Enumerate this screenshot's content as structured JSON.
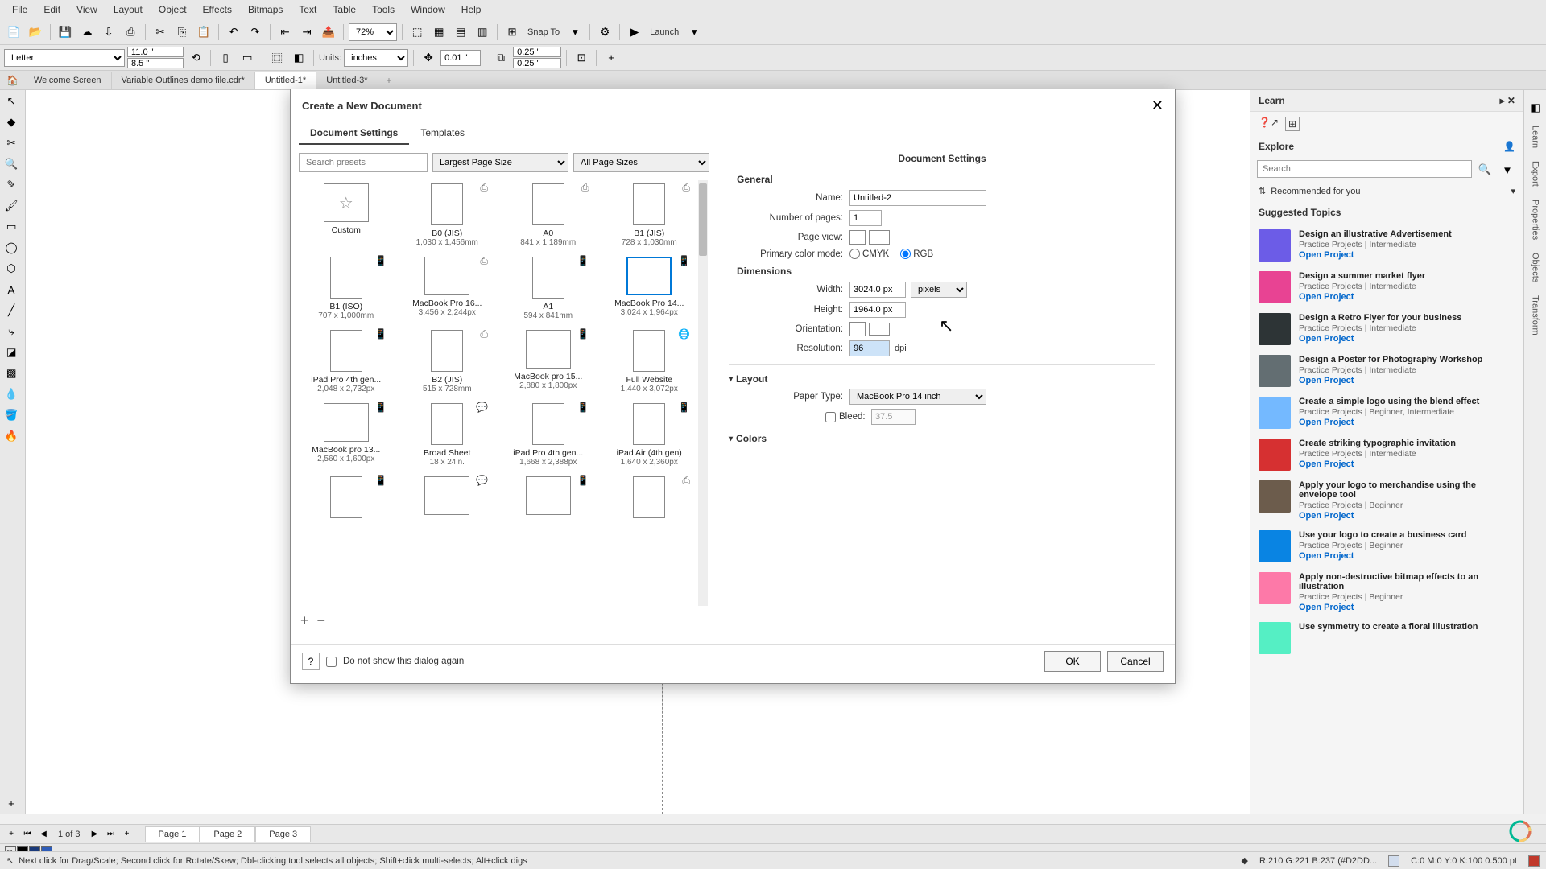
{
  "menubar": [
    "File",
    "Edit",
    "View",
    "Layout",
    "Object",
    "Effects",
    "Bitmaps",
    "Text",
    "Table",
    "Tools",
    "Window",
    "Help"
  ],
  "toolbar1": {
    "zoom": "72%",
    "snap_label": "Snap To",
    "launch_label": "Launch"
  },
  "toolbar2": {
    "paper": "Letter",
    "w": "11.0 \"",
    "h": "8.5 \"",
    "units_label": "Units:",
    "units_value": "inches",
    "nudge": "0.01 \"",
    "dup_x": "0.25 \"",
    "dup_y": "0.25 \""
  },
  "doc_tabs": [
    "Welcome Screen",
    "Variable Outlines demo file.cdr*",
    "Untitled-1*",
    "Untitled-3*"
  ],
  "active_doc_tab": 2,
  "dialog": {
    "title": "Create a New Document",
    "tabs": [
      "Document Settings",
      "Templates"
    ],
    "active_tab": 0,
    "search_placeholder": "Search presets",
    "sort_value": "Largest Page Size",
    "filter_value": "All Page Sizes",
    "presets": [
      {
        "name": "Custom",
        "dim": "",
        "shape": "star"
      },
      {
        "name": "B0 (JIS)",
        "dim": "1,030 x 1,456mm",
        "shape": "portrait",
        "badge": "⎙"
      },
      {
        "name": "A0",
        "dim": "841 x 1,189mm",
        "shape": "portrait",
        "badge": "⎙"
      },
      {
        "name": "B1 (JIS)",
        "dim": "728 x 1,030mm",
        "shape": "portrait",
        "badge": "⎙"
      },
      {
        "name": "B1 (ISO)",
        "dim": "707 x 1,000mm",
        "shape": "portrait",
        "badge": "📱"
      },
      {
        "name": "MacBook Pro 16...",
        "dim": "3,456 x 2,244px",
        "shape": "landscape",
        "badge": "⎙"
      },
      {
        "name": "A1",
        "dim": "594 x 841mm",
        "shape": "portrait",
        "badge": "📱"
      },
      {
        "name": "MacBook Pro 14...",
        "dim": "3,024 x 1,964px",
        "shape": "landscape",
        "selected": true,
        "badge": "📱"
      },
      {
        "name": "iPad Pro 4th gen...",
        "dim": "2,048 x 2,732px",
        "shape": "portrait",
        "badge": "📱"
      },
      {
        "name": "B2 (JIS)",
        "dim": "515 x 728mm",
        "shape": "portrait",
        "badge": "⎙"
      },
      {
        "name": "MacBook pro 15...",
        "dim": "2,880 x 1,800px",
        "shape": "landscape",
        "badge": "📱"
      },
      {
        "name": "Full Website",
        "dim": "1,440 x 3,072px",
        "shape": "portrait",
        "badge": "🌐"
      },
      {
        "name": "MacBook pro 13...",
        "dim": "2,560 x 1,600px",
        "shape": "landscape",
        "badge": "📱"
      },
      {
        "name": "Broad Sheet",
        "dim": "18 x 24in.",
        "shape": "portrait",
        "badge": "💬"
      },
      {
        "name": "iPad Pro 4th gen...",
        "dim": "1,668 x 2,388px",
        "shape": "portrait",
        "badge": "📱"
      },
      {
        "name": "iPad Air (4th gen)",
        "dim": "1,640 x 2,360px",
        "shape": "portrait",
        "badge": "📱"
      },
      {
        "name": "",
        "dim": "",
        "shape": "portrait",
        "badge": "📱"
      },
      {
        "name": "",
        "dim": "",
        "shape": "landscape",
        "badge": "💬"
      },
      {
        "name": "",
        "dim": "",
        "shape": "landscape",
        "badge": "📱"
      },
      {
        "name": "",
        "dim": "",
        "shape": "portrait",
        "badge": "⎙"
      }
    ],
    "settings": {
      "header": "Document Settings",
      "general_h": "General",
      "name_label": "Name:",
      "name_value": "Untitled-2",
      "pages_label": "Number of pages:",
      "pages_value": "1",
      "pageview_label": "Page view:",
      "colormode_label": "Primary color mode:",
      "cmyk": "CMYK",
      "rgb": "RGB",
      "dimensions_h": "Dimensions",
      "width_label": "Width:",
      "width_value": "3024.0 px",
      "width_unit": "pixels",
      "height_label": "Height:",
      "height_value": "1964.0 px",
      "orient_label": "Orientation:",
      "res_label": "Resolution:",
      "res_value": "96",
      "res_unit": "dpi",
      "layout_h": "Layout",
      "papertype_label": "Paper Type:",
      "papertype_value": "MacBook Pro 14 inch",
      "bleed_label": "Bleed:",
      "bleed_value": "37.5",
      "colors_h": "Colors"
    },
    "footer": {
      "help": "?",
      "dont_show": "Do not show this dialog again",
      "ok": "OK",
      "cancel": "Cancel"
    }
  },
  "right": {
    "learn_header": "Learn",
    "explore_header": "Explore",
    "search_placeholder": "Search",
    "rec_label": "Recommended for you",
    "suggested_header": "Suggested Topics",
    "topics": [
      {
        "title": "Design an illustrative Advertisement",
        "meta": "Practice Projects | Intermediate",
        "link": "Open Project",
        "color": "#6c5ce7"
      },
      {
        "title": "Design a summer market flyer",
        "meta": "Practice Projects | Intermediate",
        "link": "Open Project",
        "color": "#e84393"
      },
      {
        "title": "Design a Retro Flyer for your business",
        "meta": "Practice Projects | Intermediate",
        "link": "Open Project",
        "color": "#2d3436"
      },
      {
        "title": "Design a Poster for Photography Workshop",
        "meta": "Practice Projects | Intermediate",
        "link": "Open Project",
        "color": "#636e72"
      },
      {
        "title": "Create a simple logo using the blend effect",
        "meta": "Practice Projects | Beginner, Intermediate",
        "link": "Open Project",
        "color": "#74b9ff"
      },
      {
        "title": "Create striking typographic invitation",
        "meta": "Practice Projects | Intermediate",
        "link": "Open Project",
        "color": "#d63031"
      },
      {
        "title": "Apply your logo to merchandise using the envelope tool",
        "meta": "Practice Projects | Beginner",
        "link": "Open Project",
        "color": "#6c5c4c"
      },
      {
        "title": "Use your logo to create a business card",
        "meta": "Practice Projects | Beginner",
        "link": "Open Project",
        "color": "#0984e3"
      },
      {
        "title": "Apply non-destructive bitmap effects to an illustration",
        "meta": "Practice Projects | Beginner",
        "link": "Open Project",
        "color": "#fd79a8"
      },
      {
        "title": "Use symmetry to create a floral illustration",
        "meta": "",
        "link": "",
        "color": "#55efc4"
      }
    ]
  },
  "dock_tabs": [
    "Learn",
    "Export",
    "Properties",
    "Objects",
    "Transform"
  ],
  "page_nav": {
    "count": "1 of 3",
    "pages": [
      "Page 1",
      "Page 2",
      "Page 3"
    ]
  },
  "status": {
    "hint": "Next click for Drag/Scale; Second click for Rotate/Skew; Dbl-clicking tool selects all objects; Shift+click multi-selects; Alt+click digs",
    "coords": "R:210 G:221 B:237 (#D2DD...",
    "cmyk": "C:0 M:0 Y:0 K:100  0.500 pt"
  }
}
